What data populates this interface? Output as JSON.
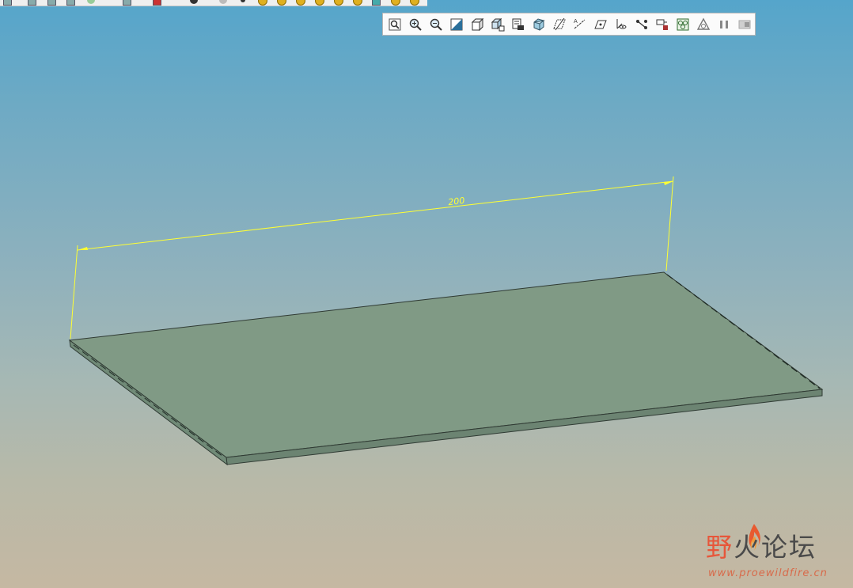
{
  "view_toolbar": {
    "buttons": [
      {
        "name": "refit-icon"
      },
      {
        "name": "zoom-in-icon"
      },
      {
        "name": "zoom-out-icon"
      },
      {
        "name": "repaint-icon"
      },
      {
        "name": "orient-icon"
      },
      {
        "name": "saved-views-icon"
      },
      {
        "name": "layers-icon"
      },
      {
        "name": "display-style-icon"
      },
      {
        "name": "datum-planes-icon"
      },
      {
        "name": "datum-axes-icon"
      },
      {
        "name": "datum-points-icon"
      },
      {
        "name": "coordinate-systems-icon"
      },
      {
        "name": "annotations-icon"
      },
      {
        "name": "spin-center-icon"
      },
      {
        "name": "model-tree-icon"
      },
      {
        "name": "appearance-icon"
      },
      {
        "name": "visibility-icon"
      },
      {
        "name": "pause-icon"
      },
      {
        "name": "disabled-command-icon"
      }
    ]
  },
  "model": {
    "dimension_label": "200",
    "dimension_color": "#ffff33",
    "plate_top_color": "#809a85",
    "plate_edge_color": "#6c8472"
  },
  "watermark": {
    "title_first": "野",
    "title_rest": "火论坛",
    "url": "www.proewildfire.cn"
  }
}
